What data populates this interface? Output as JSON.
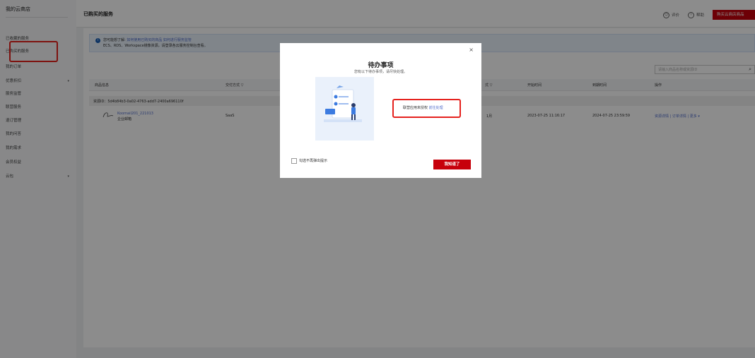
{
  "sidebar": {
    "title": "我的云商店",
    "items": [
      {
        "label": "已收藏的服务"
      },
      {
        "label": "已购买的服务"
      },
      {
        "label": "我的订单"
      },
      {
        "label": "优惠折扣"
      },
      {
        "label": "服务监管"
      },
      {
        "label": "联营服务"
      },
      {
        "label": "退订管理"
      },
      {
        "label": "我的问答"
      },
      {
        "label": "我的需求"
      },
      {
        "label": "会员权益"
      },
      {
        "label": "云包"
      }
    ]
  },
  "header": {
    "title": "已购买的服务",
    "eval_label": "评价",
    "help_label": "帮助",
    "buy_button": "购买云商店商品"
  },
  "notice": {
    "prefix": "您可能想了解:",
    "link": "如何使用已购买的商品 如何进行服务监管",
    "line2": "ECS、RDS、Workspace镜像资源，请登录各云服务控制台查看。"
  },
  "search": {
    "placeholder": "请输入商品名称或资源ID"
  },
  "table": {
    "headers": [
      "商品信息",
      "交付方式",
      "式",
      "开始时间",
      "到期时间",
      "操作"
    ],
    "resource_id": "资源ID：5d4b84b3-0a02-4763-add7-2400a696110f",
    "row": {
      "product_name": "Koomail201_221013",
      "product_type": "企业邮箱",
      "delivery": "SaaS",
      "period": "1月",
      "start": "2023-07-25 11:16:17",
      "end": "2024-07-25 23:59:59",
      "actions": "资源详情 | 订单详情 | 更多 ▾"
    }
  },
  "modal": {
    "title": "待办事项",
    "subtitle": "您有以下待办事项，请尽快处理。",
    "item_text": "联营应用未授权",
    "item_link": "前往处理",
    "checkbox_label": "勾选不再弹出提示",
    "ok_button": "我知道了",
    "close": "×"
  },
  "colors": {
    "accent": "#c7000b",
    "link": "#526ecc",
    "highlight": "#e5211d"
  }
}
